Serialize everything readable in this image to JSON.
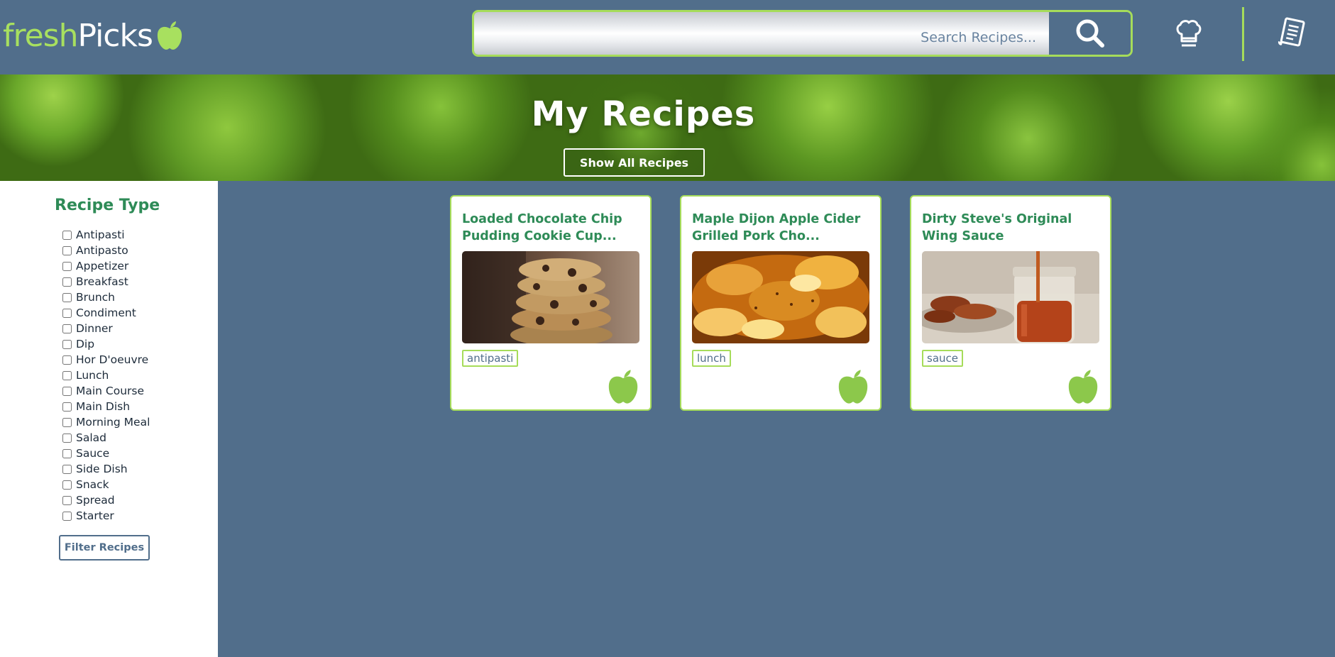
{
  "header": {
    "logo_fresh": "fresh",
    "logo_picks": "Picks",
    "search_placeholder": "Search Recipes...",
    "icons": [
      "apple-icon",
      "search-icon",
      "chef-hat-icon",
      "recipe-list-icon"
    ]
  },
  "banner": {
    "title": "My Recipes",
    "show_all_label": "Show All Recipes"
  },
  "sidebar": {
    "title": "Recipe Type",
    "types": [
      "Antipasti",
      "Antipasto",
      "Appetizer",
      "Breakfast",
      "Brunch",
      "Condiment",
      "Dinner",
      "Dip",
      "Hor D'oeuvre",
      "Lunch",
      "Main Course",
      "Main Dish",
      "Morning Meal",
      "Salad",
      "Sauce",
      "Side Dish",
      "Snack",
      "Spread",
      "Starter"
    ],
    "filter_label": "Filter Recipes"
  },
  "recipes": [
    {
      "title": "Loaded Chocolate Chip Pudding Cookie Cup...",
      "tag": "antipasti",
      "image": "cookies-photo"
    },
    {
      "title": "Maple Dijon Apple Cider Grilled Pork Cho...",
      "tag": "lunch",
      "image": "apple-pork-photo"
    },
    {
      "title": "Dirty Steve's Original Wing Sauce",
      "tag": "sauce",
      "image": "wing-sauce-photo"
    }
  ],
  "colors": {
    "header_bg": "#516e8b",
    "accent_green": "#a6dc5a",
    "title_green": "#2e8b57",
    "white": "#ffffff"
  }
}
